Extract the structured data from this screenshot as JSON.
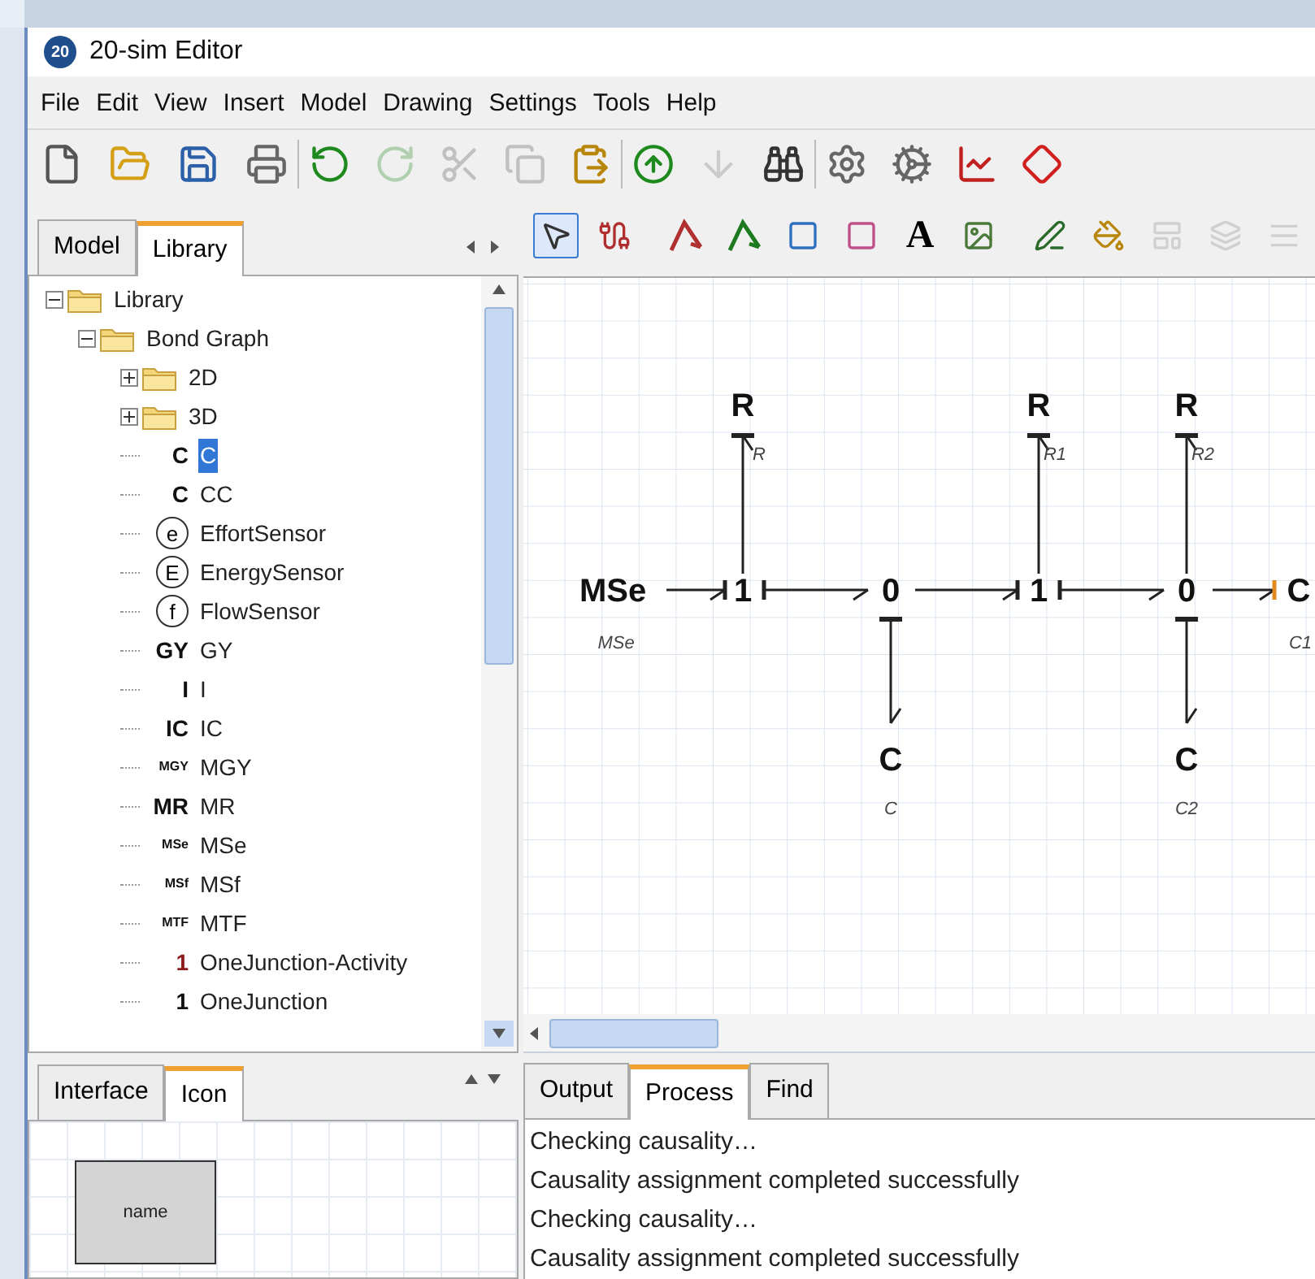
{
  "window": {
    "title": "20-sim Editor",
    "app_badge": "20"
  },
  "menu": [
    "File",
    "Edit",
    "View",
    "Insert",
    "Model",
    "Drawing",
    "Settings",
    "Tools",
    "Help"
  ],
  "toolbar": [
    [
      {
        "kind": "new",
        "disabled": false
      },
      {
        "kind": "open",
        "disabled": false
      },
      {
        "kind": "save",
        "disabled": false
      },
      {
        "kind": "print",
        "disabled": false
      }
    ],
    [
      {
        "kind": "undo",
        "disabled": false
      },
      {
        "kind": "redo",
        "disabled": true
      },
      {
        "kind": "cut",
        "disabled": true
      },
      {
        "kind": "copy",
        "disabled": true
      },
      {
        "kind": "paste",
        "disabled": false
      }
    ],
    [
      {
        "kind": "go-up",
        "disabled": false
      },
      {
        "kind": "go-down",
        "disabled": true
      },
      {
        "kind": "find",
        "disabled": false
      }
    ],
    [
      {
        "kind": "gear",
        "disabled": false
      },
      {
        "kind": "gears",
        "disabled": false
      },
      {
        "kind": "plot",
        "disabled": false
      },
      {
        "kind": "diamond",
        "disabled": false
      }
    ]
  ],
  "left_tabs": [
    {
      "label": "Model",
      "selected": false
    },
    {
      "label": "Library",
      "selected": true
    }
  ],
  "tree": [
    {
      "kind": "folder",
      "label": "Library",
      "expanded": true,
      "selected": false,
      "children": [
        {
          "kind": "folder",
          "label": "Bond Graph",
          "expanded": true,
          "selected": false,
          "children": [
            {
              "kind": "folder",
              "label": "2D",
              "expanded": false,
              "selected": false
            },
            {
              "kind": "folder",
              "label": "3D",
              "expanded": false,
              "selected": false
            },
            {
              "kind": "symbol",
              "symbol": "C",
              "label": "C",
              "selected": true
            },
            {
              "kind": "symbol",
              "symbol": "C",
              "label": "CC",
              "selected": false
            },
            {
              "kind": "circled",
              "symbol": "e",
              "label": "EffortSensor",
              "selected": false
            },
            {
              "kind": "circled",
              "symbol": "E",
              "label": "EnergySensor",
              "selected": false
            },
            {
              "kind": "circled",
              "symbol": "f",
              "label": "FlowSensor",
              "selected": false
            },
            {
              "kind": "symbol",
              "symbol": "GY",
              "label": "GY",
              "selected": false
            },
            {
              "kind": "symbol",
              "symbol": "I",
              "label": "I",
              "selected": false
            },
            {
              "kind": "symbol",
              "symbol": "IC",
              "label": "IC",
              "selected": false
            },
            {
              "kind": "symbol",
              "symbol": "MGY",
              "label": "MGY",
              "selected": false
            },
            {
              "kind": "symbol",
              "symbol": "MR",
              "label": "MR",
              "selected": false
            },
            {
              "kind": "symbol",
              "symbol": "MSe",
              "label": "MSe",
              "selected": false
            },
            {
              "kind": "symbol",
              "symbol": "MSf",
              "label": "MSf",
              "selected": false
            },
            {
              "kind": "symbol",
              "symbol": "MTF",
              "label": "MTF",
              "selected": false
            },
            {
              "kind": "symbol",
              "symbol": "1",
              "label": "OneJunction-Activity",
              "selected": false,
              "color": "#8b1a1a"
            },
            {
              "kind": "symbol",
              "symbol": "1",
              "label": "OneJunction",
              "selected": false,
              "color": "#111111"
            }
          ]
        }
      ]
    }
  ],
  "drawing_tools": [
    [
      {
        "kind": "select",
        "selected": true,
        "disabled": false
      },
      {
        "kind": "connect",
        "selected": false,
        "disabled": false
      }
    ],
    [
      {
        "kind": "bond-red",
        "selected": false,
        "disabled": false
      },
      {
        "kind": "bond-green",
        "selected": false,
        "disabled": false
      },
      {
        "kind": "rect-blue",
        "selected": false,
        "disabled": false
      },
      {
        "kind": "rect-pink",
        "selected": false,
        "disabled": false
      },
      {
        "kind": "text",
        "label": "A",
        "selected": false,
        "disabled": false
      },
      {
        "kind": "image",
        "selected": false,
        "disabled": false
      }
    ],
    [
      {
        "kind": "pen",
        "selected": false,
        "disabled": false
      },
      {
        "kind": "fill",
        "selected": false,
        "disabled": false
      },
      {
        "kind": "align",
        "selected": false,
        "disabled": true
      },
      {
        "kind": "arrange",
        "selected": false,
        "disabled": true
      },
      {
        "kind": "lines",
        "selected": false,
        "disabled": true
      }
    ]
  ],
  "diagram": {
    "elements": [
      {
        "symbol": "MSe",
        "name": "MSe"
      },
      {
        "symbol": "1"
      },
      {
        "symbol": "0"
      },
      {
        "symbol": "1"
      },
      {
        "symbol": "0"
      },
      {
        "symbol": "C",
        "name": "C1"
      },
      {
        "symbol": "R",
        "name": "R"
      },
      {
        "symbol": "R",
        "name": "R1"
      },
      {
        "symbol": "R",
        "name": "R2"
      },
      {
        "symbol": "C",
        "name": "C"
      },
      {
        "symbol": "C",
        "name": "C2"
      }
    ]
  },
  "bottom_left_tabs": [
    {
      "label": "Interface",
      "selected": false
    },
    {
      "label": "Icon",
      "selected": true
    }
  ],
  "icon_preview": {
    "label": "name"
  },
  "bottom_tabs": [
    {
      "label": "Output",
      "selected": false
    },
    {
      "label": "Process",
      "selected": true
    },
    {
      "label": "Find",
      "selected": false
    }
  ],
  "output_lines": [
    "Checking causality…",
    "Causality assignment completed successfully",
    "Checking causality…",
    "Causality assignment completed successfully"
  ]
}
